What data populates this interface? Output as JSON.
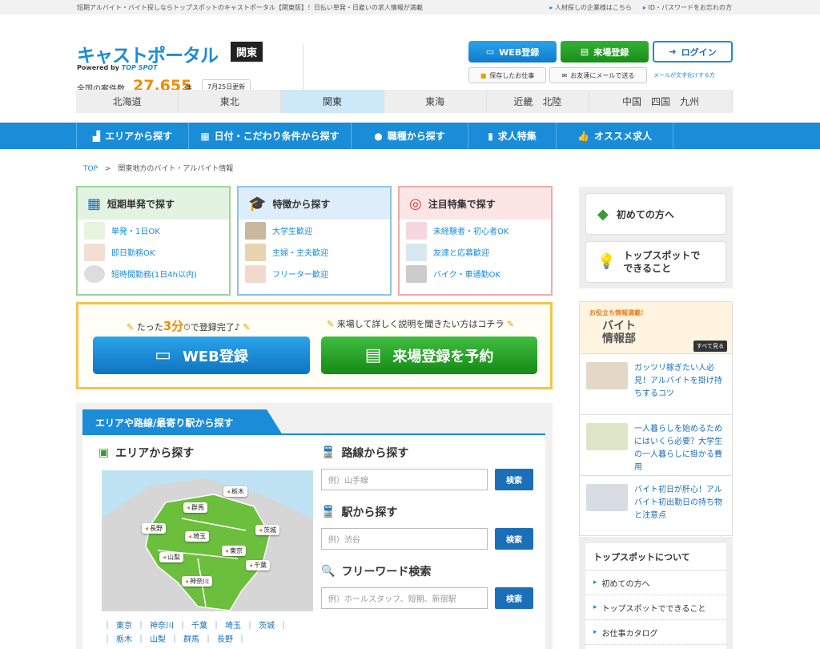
{
  "topbar": {
    "tagline": "短期アルバイト・バイト探しならトップスポットのキャストポータル【関東版】！日払い単発・日雇いの求人情報が満載",
    "links": [
      "人材探しの企業様はこちら",
      "ID・パスワードをお忘れの方"
    ]
  },
  "header": {
    "logo": "キャストポータル",
    "powered": "Powered by",
    "brand": "TOP SPOT",
    "region": "関東",
    "count_label": "全国の案件数",
    "count": "27,655",
    "count_unit": "件",
    "updated": "7月25日更新",
    "web_register": "WEB登録",
    "visit_register": "来場登録",
    "login": "ログイン",
    "saved_jobs": "保存したお仕事",
    "mail_friend": "お友達にメールで送る",
    "mail_note": "メールが文字化けする方"
  },
  "regions": [
    "北海道",
    "東北",
    "関東",
    "東海",
    "近畿　北陸",
    "中国　四国　九州"
  ],
  "active_region": "関東",
  "nav": [
    "エリアから探す",
    "日付・こだわり条件から探す",
    "職種から探す",
    "求人特集",
    "オススメ求人"
  ],
  "breadcrumb": {
    "top": "TOP",
    "sep": ">",
    "current": "関東地方のバイト・アルバイト情報"
  },
  "categories": [
    {
      "title": "短期単発で探す",
      "items": [
        "単発・1日OK",
        "即日勤務OK",
        "短時間勤務(1日4h以内)"
      ]
    },
    {
      "title": "特徴から探す",
      "items": [
        "大学生歓迎",
        "主婦・主夫歓迎",
        "フリーター歓迎"
      ]
    },
    {
      "title": "注目特集で探す",
      "items": [
        "未経験者・初心者OK",
        "友達と応募歓迎",
        "バイク・車通勤OK"
      ]
    }
  ],
  "register": {
    "cap_left_a": "たった",
    "cap_left_num": "3分",
    "cap_left_b": "で登録完了♪",
    "cap_right": "来場して詳しく説明を聞きたい方はコチラ",
    "web": "WEB登録",
    "visit": "来場登録を予約"
  },
  "search": {
    "tab": "エリアや路線/最寄り駅から探す",
    "area_title": "エリアから探す",
    "line_title": "路線から探す",
    "line_ph": "例）山手線",
    "station_title": "駅から探す",
    "station_ph": "例）渋谷",
    "free_title": "フリーワード検索",
    "free_ph": "例）ホールスタッフ、短期、新宿駅",
    "search_btn": "検索",
    "map_pins": [
      "栃木",
      "群馬",
      "長野",
      "埼玉",
      "茨城",
      "山梨",
      "東京",
      "千葉",
      "神奈川"
    ],
    "pref_links_1": [
      "東京",
      "神奈川",
      "千葉",
      "埼玉",
      "茨城"
    ],
    "pref_links_2": [
      "栃木",
      "山梨",
      "群馬",
      "長野"
    ]
  },
  "side": {
    "first": "初めての方へ",
    "can_do_1": "トップスポットで",
    "can_do_2": "できること",
    "banner_t1": "お役立ち情報満載！",
    "banner_t2a": "バイト",
    "banner_t2b": "情報部",
    "banner_all": "すべて見る",
    "articles": [
      "ガッツリ稼ぎたい人必見！アルバイトを掛け持ちするコツ",
      "一人暮らしを始めるためにはいくら必要？大学生の一人暮らしに掛かる費用",
      "バイト初日が肝心！アルバイト初出勤日の持ち物と注意点"
    ],
    "about_title": "トップスポットについて",
    "about_items": [
      "初めての方へ",
      "トップスポットでできること",
      "お仕事カタログ"
    ]
  },
  "colors": {
    "accent": "#1a8cd8",
    "green": "#33b133",
    "orange": "#f08c00"
  }
}
